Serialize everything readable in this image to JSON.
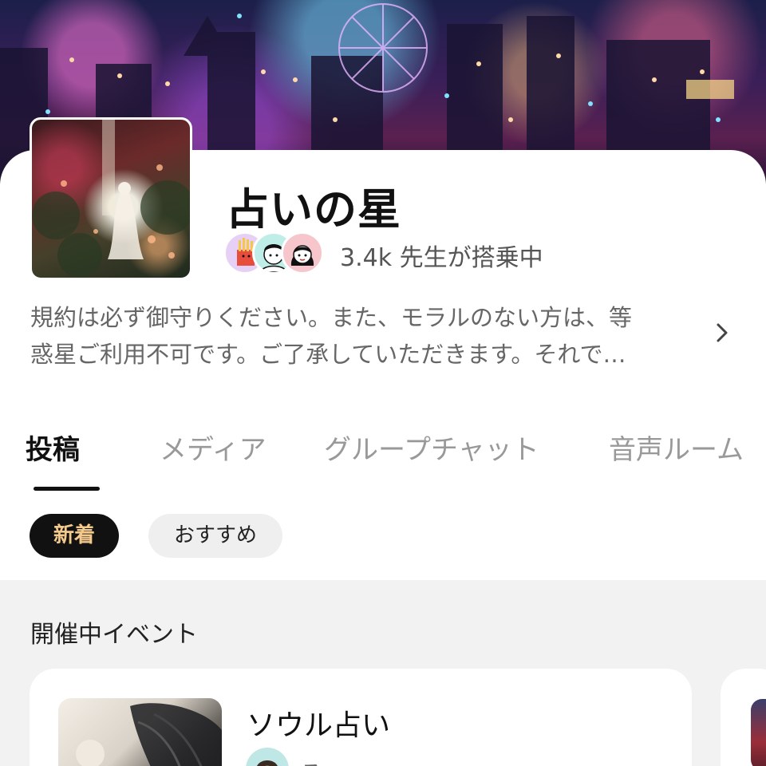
{
  "community": {
    "title": "占いの星",
    "members_text": "3.4k 先生が搭乗中",
    "description_line1": "規約は必ず御守りください。また、モラルのない方は、等",
    "description_line2": "惑星ご利用不可です。ご了承していただきます。それで…"
  },
  "tabs": [
    {
      "label": "投稿",
      "active": true
    },
    {
      "label": "メディア",
      "active": false
    },
    {
      "label": "グループチャット",
      "active": false
    },
    {
      "label": "音声ルーム",
      "active": false
    }
  ],
  "filters": [
    {
      "label": "新着",
      "active": true
    },
    {
      "label": "おすすめ",
      "active": false
    }
  ],
  "events_section": {
    "title": "開催中イベント",
    "cards": [
      {
        "title": "ソウル占い",
        "host": "る…"
      }
    ]
  },
  "icons": {
    "description_chevron": "chevron-right-icon"
  },
  "colors": {
    "active_chip_bg": "#111111",
    "active_chip_text": "#f4c98c",
    "section_bg": "#f2f2f2",
    "tab_inactive": "#999999"
  }
}
